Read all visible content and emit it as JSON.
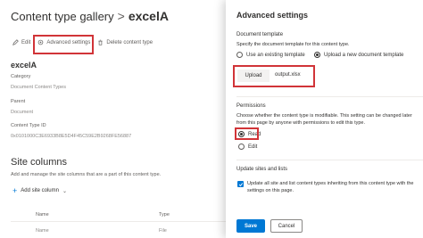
{
  "breadcrumb": {
    "root": "Content type gallery",
    "separator": ">",
    "current": "excelA"
  },
  "command_bar": {
    "edit": "Edit",
    "advanced": "Advanced settings",
    "delete": "Delete content type"
  },
  "details": {
    "name": "excelA",
    "category_label": "Category",
    "category_value": "Document Content Types",
    "parent_label": "Parent",
    "parent_value": "Document",
    "id_label": "Content Type ID",
    "id_value": "0x0101000C3E6933B8E5D4F45C59E2B9268FE56887"
  },
  "site_columns": {
    "title": "Site columns",
    "description": "Add and manage the site columns that are a part of this content type.",
    "add_label": "Add site column",
    "headers": [
      "Name",
      "Type"
    ],
    "row": [
      "Name",
      "File"
    ]
  },
  "panel": {
    "title": "Advanced settings",
    "doc_template": {
      "title": "Document template",
      "desc": "Specify the document template for this content type.",
      "options": [
        "Use an existing template",
        "Upload a new document template"
      ],
      "selected_index": 1,
      "upload_label": "Upload",
      "file_name": "output.xlsx"
    },
    "permissions": {
      "title": "Permissions",
      "desc": [
        "Choose whether the content type is modifiable. This setting can be changed later",
        "from this page by anyone with permissions to edit this type."
      ],
      "options": [
        "Read",
        "Edit"
      ],
      "selected_index": 0
    },
    "update": {
      "title": "Update sites and lists",
      "checkbox_text": [
        "Update all site and list content types inheriting from this content type with the",
        "settings on this page."
      ],
      "checked": true
    },
    "save_label": "Save",
    "cancel_label": "Cancel"
  },
  "colors": {
    "accent": "#0078d4",
    "highlight": "#d13438"
  }
}
